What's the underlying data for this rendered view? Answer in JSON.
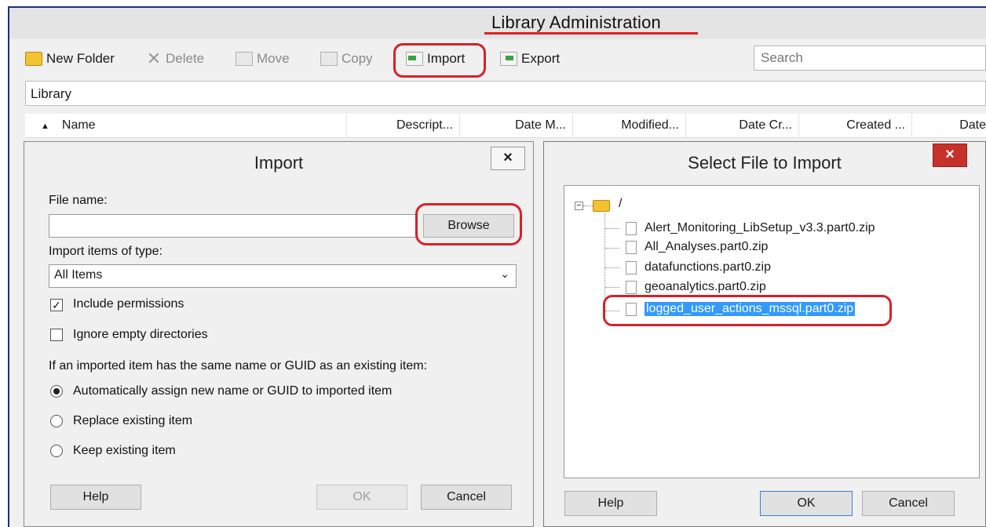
{
  "window": {
    "title": "Library Administration"
  },
  "toolbar": {
    "new_folder": "New Folder",
    "delete": "Delete",
    "move": "Move",
    "copy": "Copy",
    "import": "Import",
    "export": "Export",
    "search_placeholder": "Search"
  },
  "breadcrumb": "Library",
  "columns": [
    "Name",
    "Descript...",
    "Date M...",
    "Modified...",
    "Date Cr...",
    "Created ...",
    "Date"
  ],
  "import_dialog": {
    "title": "Import",
    "close": "×",
    "file_name_label": "File name:",
    "file_name_value": "",
    "browse": "Browse",
    "type_label": "Import items of type:",
    "type_value": "All Items",
    "include_permissions": "Include permissions",
    "include_permissions_checked": true,
    "ignore_empty": "Ignore empty directories",
    "ignore_empty_checked": false,
    "conflict_label": "If an imported item has the same name or GUID as an existing item:",
    "options": [
      "Automatically assign new name or GUID to imported item",
      "Replace existing item",
      "Keep existing item"
    ],
    "selected_option": 0,
    "help": "Help",
    "ok": "OK",
    "cancel": "Cancel"
  },
  "select_file_dialog": {
    "title": "Select File to Import",
    "close": "×",
    "root": "/",
    "files": [
      "Alert_Monitoring_LibSetup_v3.3.part0.zip",
      "All_Analyses.part0.zip",
      "datafunctions.part0.zip",
      "geoanalytics.part0.zip",
      "logged_user_actions_mssql.part0.zip"
    ],
    "selected_index": 4,
    "help": "Help",
    "ok": "OK",
    "cancel": "Cancel"
  },
  "colors": {
    "highlight": "#d8202a",
    "selection": "#3399ff",
    "close_red": "#c7312b"
  }
}
